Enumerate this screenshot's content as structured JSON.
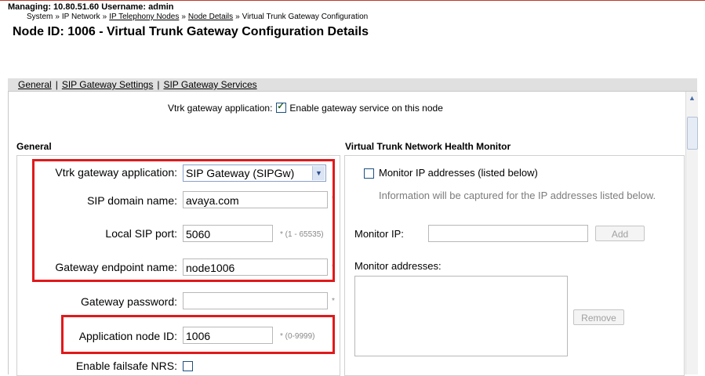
{
  "header": {
    "managing_label": "Managing: 10.80.51.60  Username: admin",
    "breadcrumb": [
      {
        "label": "System",
        "link": false
      },
      {
        "label": "IP Network",
        "link": false
      },
      {
        "label": "IP Telephony Nodes",
        "link": true
      },
      {
        "label": "Node Details",
        "link": true
      },
      {
        "label": "Virtual Trunk Gateway Configuration",
        "link": false
      }
    ],
    "breadcrumb_separator": "»",
    "page_title": "Node ID: 1006 - Virtual Trunk Gateway Configuration Details"
  },
  "tabs": {
    "general": "General",
    "sip_gateway_settings": "SIP Gateway Settings",
    "sip_gateway_services": "SIP Gateway Services",
    "separator": "|"
  },
  "enable_row": {
    "label": "Vtrk gateway application:",
    "checkbox_label": "Enable gateway service on this node",
    "checked": true
  },
  "general": {
    "section_title": "General",
    "vtrk_app_label": "Vtrk gateway application:",
    "vtrk_app_value": "SIP Gateway (SIPGw)",
    "sip_domain_label": "SIP domain name:",
    "sip_domain_value": "avaya.com",
    "local_sip_port_label": "Local SIP port:",
    "local_sip_port_value": "5060",
    "local_sip_port_hint": "* (1 - 65535)",
    "endpoint_name_label": "Gateway endpoint name:",
    "endpoint_name_value": "node1006",
    "gateway_password_label": "Gateway password:",
    "gateway_password_value": "",
    "app_node_id_label": "Application node ID:",
    "app_node_id_value": "1006",
    "app_node_id_hint": "* (0-9999)",
    "failsafe_label": "Enable failsafe NRS:",
    "required_mark": "*"
  },
  "health_monitor": {
    "section_title": "Virtual Trunk Network Health Monitor",
    "monitor_checkbox_label": "Monitor IP addresses (listed below)",
    "info_text": "Information will be captured for the IP addresses listed below.",
    "monitor_ip_label": "Monitor IP:",
    "monitor_ip_value": "",
    "add_button": "Add",
    "monitor_addresses_label": "Monitor addresses:",
    "remove_button": "Remove"
  },
  "colors": {
    "highlight_red": "#e0191b",
    "tab_bar_bg": "#e0e0e0"
  }
}
